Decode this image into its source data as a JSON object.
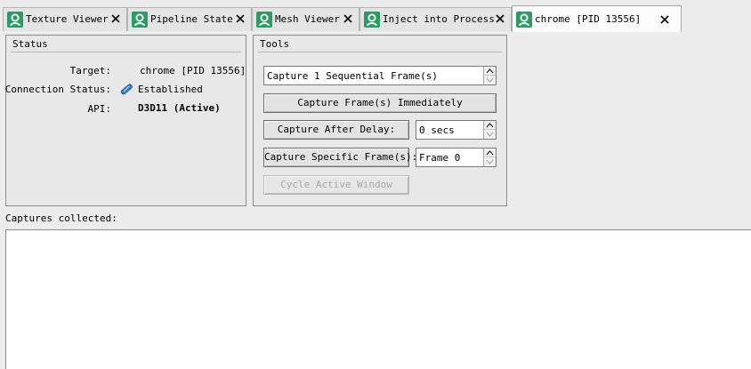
{
  "tabs": [
    {
      "label": "Texture Viewer",
      "icon": "person-icon",
      "active": false
    },
    {
      "label": "Pipeline State",
      "icon": "person-icon",
      "active": false
    },
    {
      "label": "Mesh Viewer",
      "icon": "person-icon",
      "active": false
    },
    {
      "label": "Inject into Process",
      "icon": "person-icon",
      "active": false
    },
    {
      "label": "chrome [PID 13556]",
      "icon": "person-icon",
      "active": true
    }
  ],
  "status": {
    "title": "Status",
    "target_label": "Target:",
    "target_value": "chrome [PID 13556]",
    "connection_label": "Connection Status:",
    "connection_value": "Established",
    "connection_icon": "connected-plug-icon",
    "api_label": "API:",
    "api_value": "D3D11 (Active)"
  },
  "tools": {
    "title": "Tools",
    "sequential_value": "Capture 1 Sequential Frame(s)",
    "capture_immediately_label": "Capture Frame(s) Immediately",
    "capture_after_delay_label": "Capture After Delay:",
    "delay_value": "0 secs",
    "capture_specific_label": "Capture Specific Frame(s):",
    "frame_value": "Frame 0",
    "cycle_window_label": "Cycle Active Window"
  },
  "captures": {
    "label": "Captures collected:",
    "items": []
  },
  "colors": {
    "tab_icon": "#2e9b65",
    "connection_icon": "#3a7fd0"
  }
}
